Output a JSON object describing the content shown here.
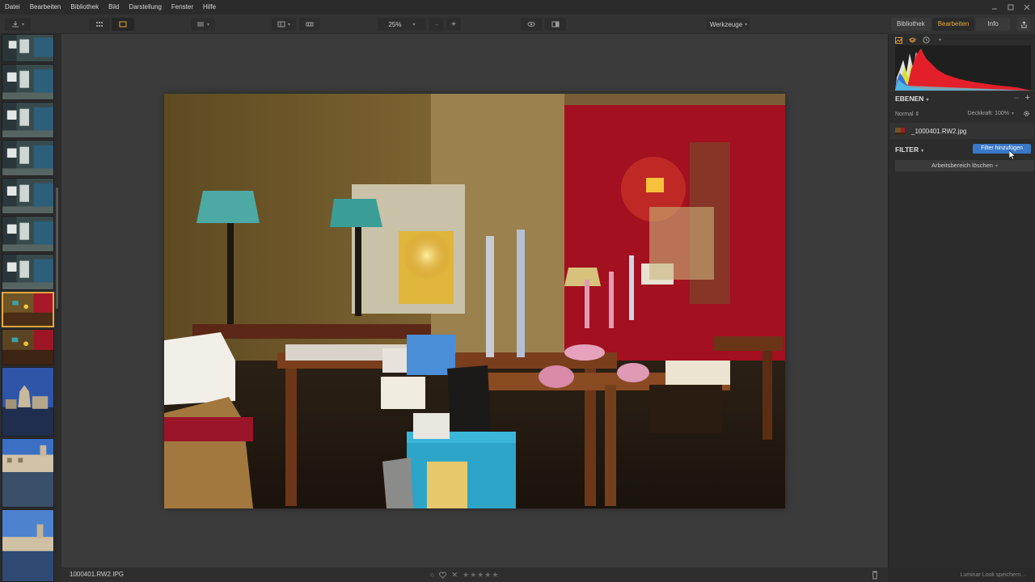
{
  "menubar": {
    "items": [
      "Datei",
      "Bearbeiten",
      "Bibliothek",
      "Bild",
      "Darstellung",
      "Fenster",
      "Hilfe"
    ]
  },
  "toolbar": {
    "zoom": "25%",
    "zoom_minus": "–",
    "zoom_plus": "+",
    "tools_label": "Werkzeuge"
  },
  "panel_tabs": {
    "items": [
      "Bibliothek",
      "Bearbeiten",
      "Info"
    ],
    "active": "Bearbeiten"
  },
  "layers": {
    "title": "EBENEN",
    "add": "+",
    "remove": "–",
    "blend_mode": "Normal",
    "opacity": "Deckkraft: 100%",
    "layer_name": "_1000401.RW2.jpg"
  },
  "filters": {
    "title": "FILTER",
    "add_button": "Filter hinzufügen",
    "clear_button": "Arbeitsbereich löschen"
  },
  "bottombar": {
    "filename": "1000401.RW2.IPG",
    "stars": [
      "★",
      "★",
      "★",
      "★",
      "★"
    ],
    "flag_icon": "○",
    "reject_icon": "✕"
  },
  "bottom_right": {
    "save_look": "Luminar Look speichern..."
  },
  "colors": {
    "accent": "#e8a73a",
    "primary_button": "#3a78c8"
  }
}
